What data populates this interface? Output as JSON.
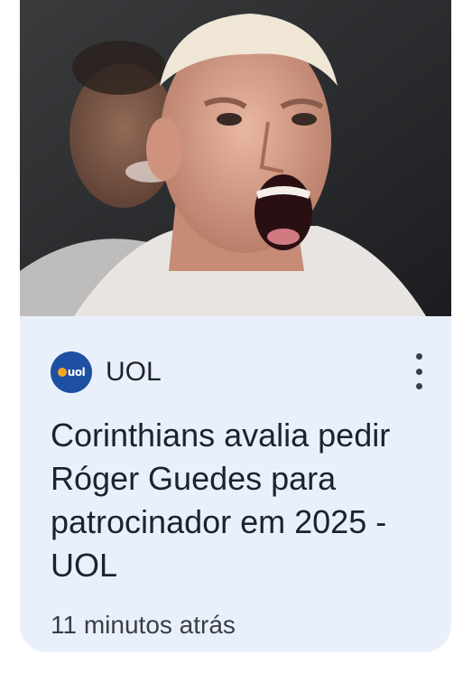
{
  "card": {
    "source_name": "UOL",
    "logo_text": "uol",
    "headline": "Corinthians avalia pedir Róger Guedes para patrocinador em 2025 - UOL",
    "timestamp": "11 minutos atrás",
    "image_description_icon": "photo-football-player-celebrating",
    "menu_icon": "more-vert-icon"
  },
  "colors": {
    "card_background": "#e9f0fb",
    "logo_background": "#1d4fa3",
    "logo_dot": "#f6a623",
    "headline_text": "#1c2230"
  }
}
